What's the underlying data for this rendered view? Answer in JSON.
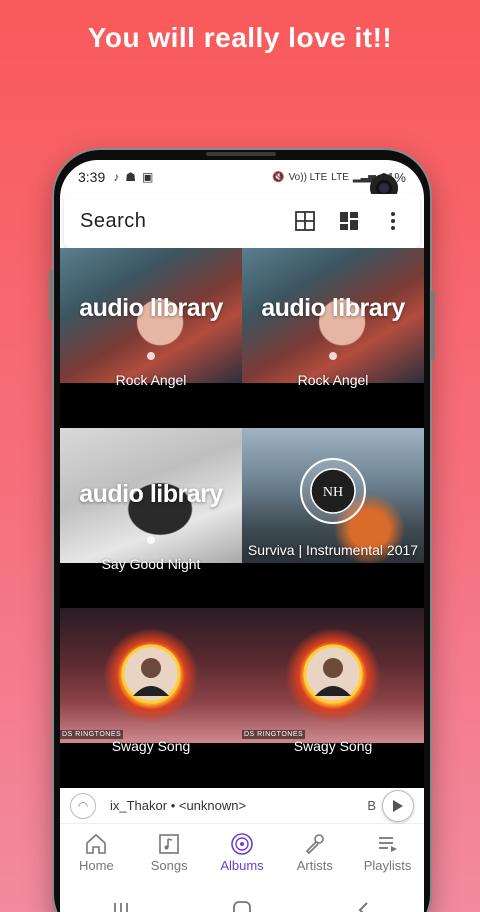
{
  "headline": "You will really love it!!",
  "status": {
    "time": "3:39",
    "network": "Vo)) LTE",
    "lte": "LTE",
    "battery": "61%"
  },
  "search": {
    "label": "Search"
  },
  "albums": [
    {
      "caption": "Rock Angel",
      "watermark": "audio library"
    },
    {
      "caption": "Rock Angel",
      "watermark": "audio library"
    },
    {
      "caption": "Say Good Night",
      "watermark": "audio library"
    },
    {
      "caption": "Surviva | Instrumental 2017",
      "watermark": ""
    },
    {
      "caption": "Swagy Song",
      "tag": "DS RINGTONES"
    },
    {
      "caption": "Swagy Song",
      "tag": "DS RINGTONES"
    }
  ],
  "miniplayer": {
    "title": "ix_Thakor • <unknown>",
    "tail": "B"
  },
  "tabs": [
    {
      "label": "Home",
      "icon": "home-icon"
    },
    {
      "label": "Songs",
      "icon": "music-note-icon"
    },
    {
      "label": "Albums",
      "icon": "disc-icon"
    },
    {
      "label": "Artists",
      "icon": "microphone-icon"
    },
    {
      "label": "Playlists",
      "icon": "playlist-icon"
    }
  ],
  "colors": {
    "accent": "#6a3fd6",
    "background_top": "#f95a5b",
    "background_bottom": "#f28ba0"
  }
}
